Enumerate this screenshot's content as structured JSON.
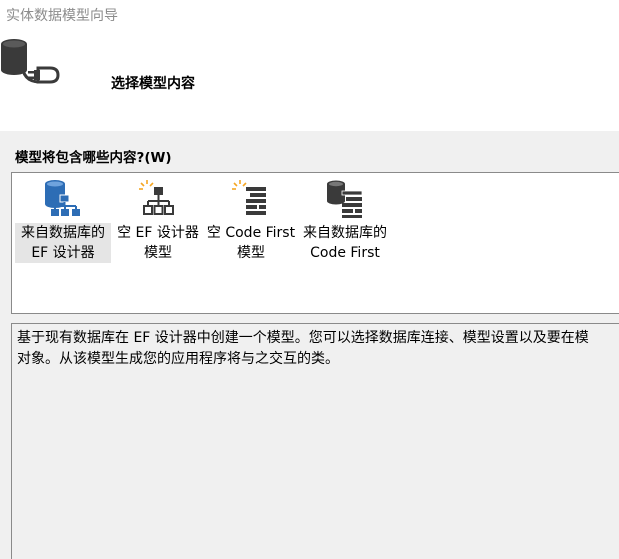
{
  "window": {
    "title": "实体数据模型向导"
  },
  "header": {
    "heading": "选择模型内容",
    "icon": "database-plug-icon"
  },
  "question": {
    "label": "模型将包含哪些内容?(W)"
  },
  "choices": [
    {
      "line1": "来自数据库的",
      "line2": "EF 设计器",
      "icon": "database-diagram-icon",
      "selected": true
    },
    {
      "line1": "空 EF 设计器",
      "line2": "模型",
      "icon": "empty-diagram-icon",
      "selected": false
    },
    {
      "line1": "空 Code First",
      "line2": "模型",
      "icon": "empty-code-first-icon",
      "selected": false
    },
    {
      "line1": "来自数据库的",
      "line2": "Code First",
      "icon": "database-code-first-icon",
      "selected": false
    }
  ],
  "description": {
    "line1": "基于现有数据库在 EF 设计器中创建一个模型。您可以选择数据库连接、模型设置以及要在模",
    "line2": "对象。从该模型生成您的应用程序将与之交互的类。"
  },
  "colors": {
    "accent": "#2d6db5",
    "spark": "#f5a623",
    "icon_dark": "#3a3a3a"
  }
}
